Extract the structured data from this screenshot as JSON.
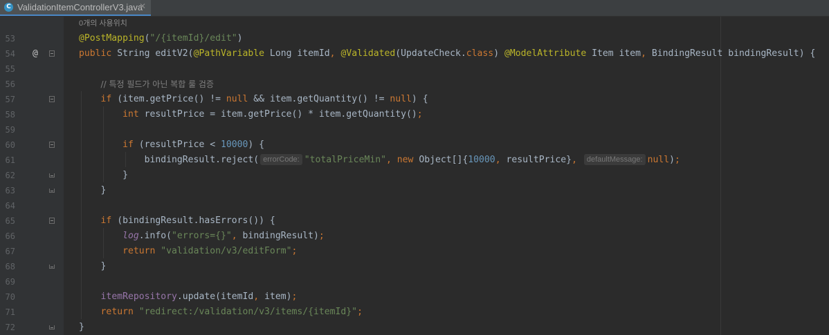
{
  "tab": {
    "icon": "java-class-icon",
    "icon_letter": "C",
    "filename": "ValidationItemControllerV3.java",
    "close": "✕"
  },
  "usage_hint": "0개의 사용위치",
  "gutter": {
    "override_marker": "@"
  },
  "lines": [
    {
      "number": "53",
      "parts": [
        {
          "t": "@PostMapping",
          "c": "an"
        },
        {
          "t": "("
        },
        {
          "t": "\"/{itemId}/edit\"",
          "c": "str"
        },
        {
          "t": ")"
        }
      ]
    },
    {
      "number": "54",
      "marker": "@",
      "fold": "start",
      "parts": [
        {
          "t": "public ",
          "c": "kw"
        },
        {
          "t": "String editV2("
        },
        {
          "t": "@PathVariable",
          "c": "an"
        },
        {
          "t": " Long itemId"
        },
        {
          "t": ", ",
          "c": "kw"
        },
        {
          "t": "@Validated",
          "c": "an"
        },
        {
          "t": "(UpdateCheck."
        },
        {
          "t": "class",
          "c": "kw"
        },
        {
          "t": ") "
        },
        {
          "t": "@ModelAttribute",
          "c": "an"
        },
        {
          "t": " Item item"
        },
        {
          "t": ", ",
          "c": "kw"
        },
        {
          "t": "BindingResult bindingResult) {"
        }
      ]
    },
    {
      "number": "55",
      "parts": []
    },
    {
      "number": "56",
      "parts": [
        {
          "t": "    "
        },
        {
          "t": "// 특정 필드가 아닌 복합 룰 검증",
          "c": "cmt"
        }
      ]
    },
    {
      "number": "57",
      "fold": "start",
      "parts": [
        {
          "t": "    "
        },
        {
          "t": "if ",
          "c": "kw"
        },
        {
          "t": "(item.getPrice() != "
        },
        {
          "t": "null ",
          "c": "kw"
        },
        {
          "t": "&& item.getQuantity() != "
        },
        {
          "t": "null",
          "c": "kw"
        },
        {
          "t": ") {"
        }
      ]
    },
    {
      "number": "58",
      "parts": [
        {
          "t": "        "
        },
        {
          "t": "int ",
          "c": "kw"
        },
        {
          "t": "resultPrice = item.getPrice() * item.getQuantity()"
        },
        {
          "t": ";",
          "c": "kw"
        }
      ]
    },
    {
      "number": "59",
      "parts": []
    },
    {
      "number": "60",
      "fold": "start",
      "parts": [
        {
          "t": "        "
        },
        {
          "t": "if ",
          "c": "kw"
        },
        {
          "t": "(resultPrice < "
        },
        {
          "t": "10000",
          "c": "num"
        },
        {
          "t": ") {"
        }
      ]
    },
    {
      "number": "61",
      "parts": [
        {
          "t": "            bindingResult.reject("
        },
        {
          "hint": "errorCode:"
        },
        {
          "t": "\"totalPriceMin\"",
          "c": "str"
        },
        {
          "t": ", ",
          "c": "kw"
        },
        {
          "t": "new ",
          "c": "kw"
        },
        {
          "t": "Object[]{"
        },
        {
          "t": "10000",
          "c": "num"
        },
        {
          "t": ", ",
          "c": "kw"
        },
        {
          "t": "resultPrice}"
        },
        {
          "t": ", ",
          "c": "kw"
        },
        {
          "hint": "defaultMessage:"
        },
        {
          "t": "null",
          "c": "kw"
        },
        {
          "t": ")"
        },
        {
          "t": ";",
          "c": "kw"
        }
      ]
    },
    {
      "number": "62",
      "fold": "end",
      "parts": [
        {
          "t": "        }"
        }
      ]
    },
    {
      "number": "63",
      "fold": "end",
      "parts": [
        {
          "t": "    }"
        }
      ]
    },
    {
      "number": "64",
      "parts": []
    },
    {
      "number": "65",
      "fold": "start",
      "parts": [
        {
          "t": "    "
        },
        {
          "t": "if ",
          "c": "kw"
        },
        {
          "t": "(bindingResult.hasErrors()) {"
        }
      ]
    },
    {
      "number": "66",
      "parts": [
        {
          "t": "        "
        },
        {
          "t": "log",
          "c": "fld it"
        },
        {
          "t": ".info("
        },
        {
          "t": "\"errors={}\"",
          "c": "str"
        },
        {
          "t": ", ",
          "c": "kw"
        },
        {
          "t": "bindingResult)"
        },
        {
          "t": ";",
          "c": "kw"
        }
      ]
    },
    {
      "number": "67",
      "parts": [
        {
          "t": "        "
        },
        {
          "t": "return ",
          "c": "kw"
        },
        {
          "t": "\"validation/v3/editForm\"",
          "c": "str"
        },
        {
          "t": ";",
          "c": "kw"
        }
      ]
    },
    {
      "number": "68",
      "fold": "end",
      "parts": [
        {
          "t": "    }"
        }
      ]
    },
    {
      "number": "69",
      "parts": []
    },
    {
      "number": "70",
      "parts": [
        {
          "t": "    "
        },
        {
          "t": "itemRepository",
          "c": "fld"
        },
        {
          "t": ".update(itemId"
        },
        {
          "t": ", ",
          "c": "kw"
        },
        {
          "t": "item)"
        },
        {
          "t": ";",
          "c": "kw"
        }
      ]
    },
    {
      "number": "71",
      "parts": [
        {
          "t": "    "
        },
        {
          "t": "return ",
          "c": "kw"
        },
        {
          "t": "\"redirect:/validation/v3/items/{itemId}\"",
          "c": "str"
        },
        {
          "t": ";",
          "c": "kw"
        }
      ]
    },
    {
      "number": "72",
      "fold": "end",
      "parts": [
        {
          "t": "}"
        }
      ]
    }
  ],
  "colors": {
    "background": "#2b2b2b",
    "gutter": "#313335",
    "keyword": "#cc7832",
    "annotation": "#bbb529",
    "string": "#6a8759",
    "number": "#6897bb",
    "field": "#9876aa",
    "comment": "#808080",
    "text": "#a9b7c6"
  }
}
